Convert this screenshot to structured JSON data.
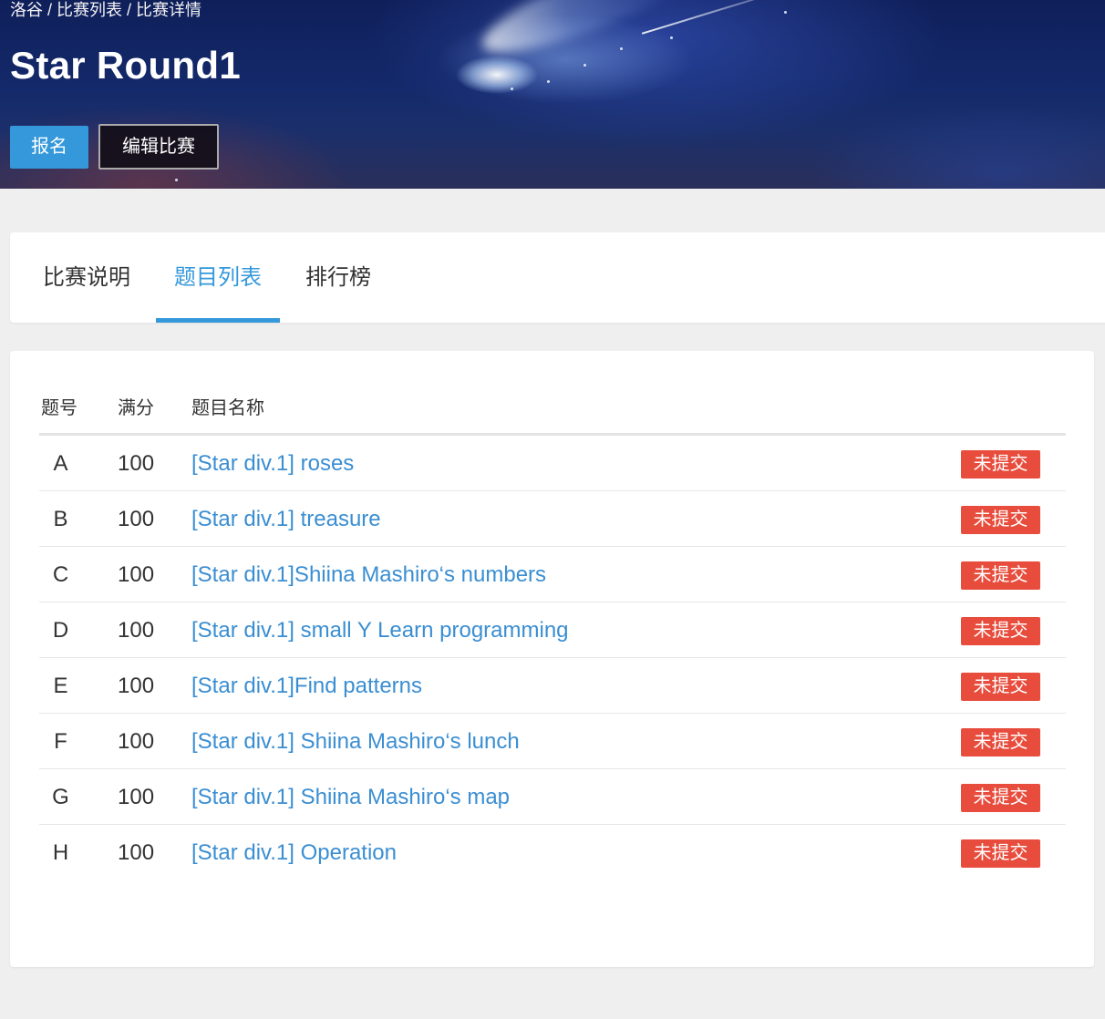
{
  "breadcrumb": [
    {
      "label": "洛谷"
    },
    {
      "label": "比赛列表"
    },
    {
      "label": "比赛详情"
    }
  ],
  "breadcrumb_separator": "/",
  "contest": {
    "title": "Star Round1",
    "signup_label": "报名",
    "edit_label": "编辑比赛"
  },
  "tabs": [
    {
      "label": "比赛说明",
      "active": false
    },
    {
      "label": "题目列表",
      "active": true
    },
    {
      "label": "排行榜",
      "active": false
    }
  ],
  "problem_table": {
    "headers": {
      "index": "题号",
      "score": "满分",
      "name": "题目名称"
    },
    "rows": [
      {
        "index": "A",
        "score": "100",
        "name": "[Star div.1] roses",
        "status": "未提交"
      },
      {
        "index": "B",
        "score": "100",
        "name": "[Star div.1] treasure",
        "status": "未提交"
      },
      {
        "index": "C",
        "score": "100",
        "name": "[Star div.1]Shiina Mashiro‘s numbers",
        "status": "未提交"
      },
      {
        "index": "D",
        "score": "100",
        "name": "[Star div.1] small Y Learn programming",
        "status": "未提交"
      },
      {
        "index": "E",
        "score": "100",
        "name": "[Star div.1]Find patterns",
        "status": "未提交"
      },
      {
        "index": "F",
        "score": "100",
        "name": "[Star div.1] Shiina Mashiro‘s lunch",
        "status": "未提交"
      },
      {
        "index": "G",
        "score": "100",
        "name": "[Star div.1] Shiina Mashiro‘s map",
        "status": "未提交"
      },
      {
        "index": "H",
        "score": "100",
        "name": "[Star div.1] Operation",
        "status": "未提交"
      }
    ]
  },
  "colors": {
    "accent": "#3498db",
    "link": "#3a8ed2",
    "status_unsubmitted": "#e74c3c",
    "page_background": "#efefef"
  }
}
